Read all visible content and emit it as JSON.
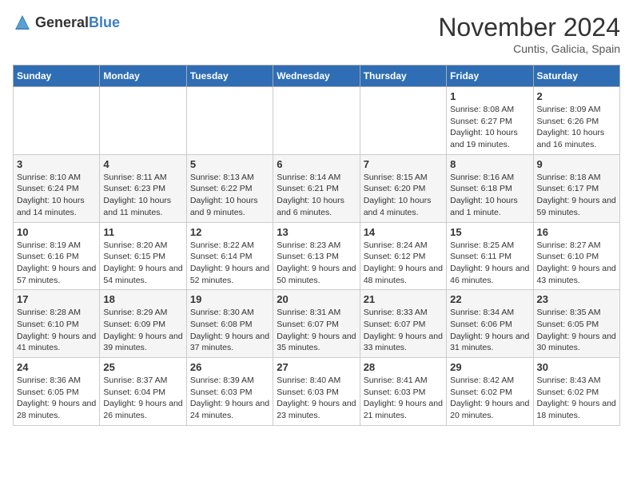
{
  "header": {
    "logo": {
      "general": "General",
      "blue": "Blue"
    },
    "title": "November 2024",
    "subtitle": "Cuntis, Galicia, Spain"
  },
  "days_of_week": [
    "Sunday",
    "Monday",
    "Tuesday",
    "Wednesday",
    "Thursday",
    "Friday",
    "Saturday"
  ],
  "weeks": [
    [
      {
        "day": "",
        "info": ""
      },
      {
        "day": "",
        "info": ""
      },
      {
        "day": "",
        "info": ""
      },
      {
        "day": "",
        "info": ""
      },
      {
        "day": "",
        "info": ""
      },
      {
        "day": "1",
        "info": "Sunrise: 8:08 AM\nSunset: 6:27 PM\nDaylight: 10 hours and 19 minutes."
      },
      {
        "day": "2",
        "info": "Sunrise: 8:09 AM\nSunset: 6:26 PM\nDaylight: 10 hours and 16 minutes."
      }
    ],
    [
      {
        "day": "3",
        "info": "Sunrise: 8:10 AM\nSunset: 6:24 PM\nDaylight: 10 hours and 14 minutes."
      },
      {
        "day": "4",
        "info": "Sunrise: 8:11 AM\nSunset: 6:23 PM\nDaylight: 10 hours and 11 minutes."
      },
      {
        "day": "5",
        "info": "Sunrise: 8:13 AM\nSunset: 6:22 PM\nDaylight: 10 hours and 9 minutes."
      },
      {
        "day": "6",
        "info": "Sunrise: 8:14 AM\nSunset: 6:21 PM\nDaylight: 10 hours and 6 minutes."
      },
      {
        "day": "7",
        "info": "Sunrise: 8:15 AM\nSunset: 6:20 PM\nDaylight: 10 hours and 4 minutes."
      },
      {
        "day": "8",
        "info": "Sunrise: 8:16 AM\nSunset: 6:18 PM\nDaylight: 10 hours and 1 minute."
      },
      {
        "day": "9",
        "info": "Sunrise: 8:18 AM\nSunset: 6:17 PM\nDaylight: 9 hours and 59 minutes."
      }
    ],
    [
      {
        "day": "10",
        "info": "Sunrise: 8:19 AM\nSunset: 6:16 PM\nDaylight: 9 hours and 57 minutes."
      },
      {
        "day": "11",
        "info": "Sunrise: 8:20 AM\nSunset: 6:15 PM\nDaylight: 9 hours and 54 minutes."
      },
      {
        "day": "12",
        "info": "Sunrise: 8:22 AM\nSunset: 6:14 PM\nDaylight: 9 hours and 52 minutes."
      },
      {
        "day": "13",
        "info": "Sunrise: 8:23 AM\nSunset: 6:13 PM\nDaylight: 9 hours and 50 minutes."
      },
      {
        "day": "14",
        "info": "Sunrise: 8:24 AM\nSunset: 6:12 PM\nDaylight: 9 hours and 48 minutes."
      },
      {
        "day": "15",
        "info": "Sunrise: 8:25 AM\nSunset: 6:11 PM\nDaylight: 9 hours and 46 minutes."
      },
      {
        "day": "16",
        "info": "Sunrise: 8:27 AM\nSunset: 6:10 PM\nDaylight: 9 hours and 43 minutes."
      }
    ],
    [
      {
        "day": "17",
        "info": "Sunrise: 8:28 AM\nSunset: 6:10 PM\nDaylight: 9 hours and 41 minutes."
      },
      {
        "day": "18",
        "info": "Sunrise: 8:29 AM\nSunset: 6:09 PM\nDaylight: 9 hours and 39 minutes."
      },
      {
        "day": "19",
        "info": "Sunrise: 8:30 AM\nSunset: 6:08 PM\nDaylight: 9 hours and 37 minutes."
      },
      {
        "day": "20",
        "info": "Sunrise: 8:31 AM\nSunset: 6:07 PM\nDaylight: 9 hours and 35 minutes."
      },
      {
        "day": "21",
        "info": "Sunrise: 8:33 AM\nSunset: 6:07 PM\nDaylight: 9 hours and 33 minutes."
      },
      {
        "day": "22",
        "info": "Sunrise: 8:34 AM\nSunset: 6:06 PM\nDaylight: 9 hours and 31 minutes."
      },
      {
        "day": "23",
        "info": "Sunrise: 8:35 AM\nSunset: 6:05 PM\nDaylight: 9 hours and 30 minutes."
      }
    ],
    [
      {
        "day": "24",
        "info": "Sunrise: 8:36 AM\nSunset: 6:05 PM\nDaylight: 9 hours and 28 minutes."
      },
      {
        "day": "25",
        "info": "Sunrise: 8:37 AM\nSunset: 6:04 PM\nDaylight: 9 hours and 26 minutes."
      },
      {
        "day": "26",
        "info": "Sunrise: 8:39 AM\nSunset: 6:03 PM\nDaylight: 9 hours and 24 minutes."
      },
      {
        "day": "27",
        "info": "Sunrise: 8:40 AM\nSunset: 6:03 PM\nDaylight: 9 hours and 23 minutes."
      },
      {
        "day": "28",
        "info": "Sunrise: 8:41 AM\nSunset: 6:03 PM\nDaylight: 9 hours and 21 minutes."
      },
      {
        "day": "29",
        "info": "Sunrise: 8:42 AM\nSunset: 6:02 PM\nDaylight: 9 hours and 20 minutes."
      },
      {
        "day": "30",
        "info": "Sunrise: 8:43 AM\nSunset: 6:02 PM\nDaylight: 9 hours and 18 minutes."
      }
    ]
  ]
}
